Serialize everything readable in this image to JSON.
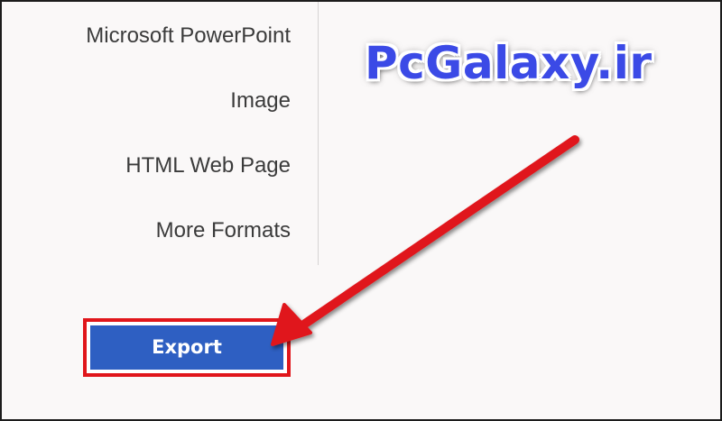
{
  "formats": {
    "items": [
      {
        "label": "Microsoft PowerPoint"
      },
      {
        "label": "Image"
      },
      {
        "label": "HTML Web Page"
      },
      {
        "label": "More Formats"
      }
    ]
  },
  "watermark": {
    "text": "PcGalaxy.ir",
    "color": "#3b4ae6"
  },
  "export": {
    "label": "Export",
    "button_color": "#2e5fc2",
    "highlight_color": "#e0161b"
  },
  "annotation": {
    "arrow_color": "#e0161b",
    "icon": "red-arrow-icon"
  }
}
